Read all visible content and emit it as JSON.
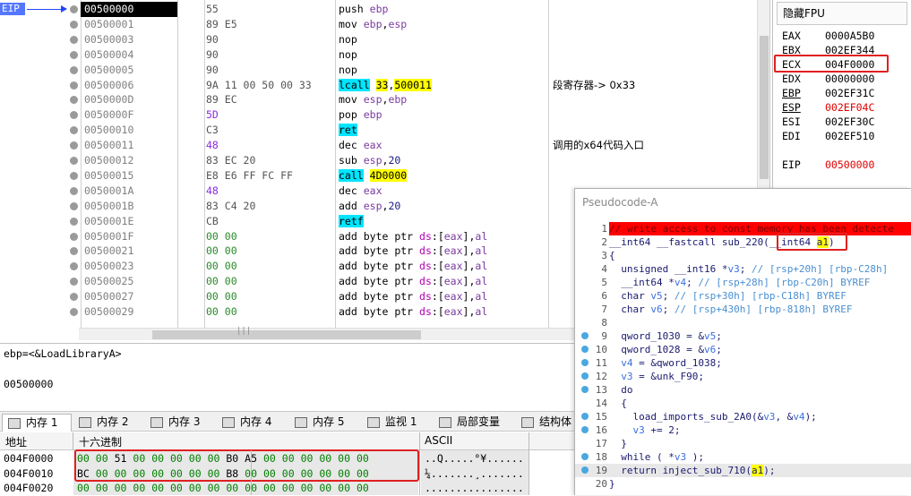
{
  "disasm": {
    "eip_label": "EIP",
    "rows": [
      {
        "addr": "00500000",
        "bytes": "55",
        "instr": "push ebp",
        "comment": ""
      },
      {
        "addr": "00500001",
        "bytes": "89 E5",
        "instr": "mov ebp,esp",
        "comment": ""
      },
      {
        "addr": "00500003",
        "bytes": "90",
        "instr": "nop",
        "comment": ""
      },
      {
        "addr": "00500004",
        "bytes": "90",
        "instr": "nop",
        "comment": ""
      },
      {
        "addr": "00500005",
        "bytes": "90",
        "instr": "nop",
        "comment": ""
      },
      {
        "addr": "00500006",
        "bytes": "9A 11 00 50 00 33",
        "instr": "lcall 33,500011",
        "comment": "段寄存器-> 0x33"
      },
      {
        "addr": "0050000D",
        "bytes": "89 EC",
        "instr": "mov esp,ebp",
        "comment": ""
      },
      {
        "addr": "0050000F",
        "bytes": "5D",
        "instr": "pop ebp",
        "comment": ""
      },
      {
        "addr": "00500010",
        "bytes": "C3",
        "instr": "ret",
        "comment": ""
      },
      {
        "addr": "00500011",
        "bytes": "48",
        "instr": "dec eax",
        "comment": "调用的x64代码入口"
      },
      {
        "addr": "00500012",
        "bytes": "83 EC 20",
        "instr": "sub esp,20",
        "comment": ""
      },
      {
        "addr": "00500015",
        "bytes": "E8 E6 FF FC FF",
        "instr": "call 4D0000",
        "comment": ""
      },
      {
        "addr": "0050001A",
        "bytes": "48",
        "instr": "dec eax",
        "comment": ""
      },
      {
        "addr": "0050001B",
        "bytes": "83 C4 20",
        "instr": "add esp,20",
        "comment": ""
      },
      {
        "addr": "0050001E",
        "bytes": "CB",
        "instr": "retf",
        "comment": ""
      },
      {
        "addr": "0050001F",
        "bytes": "00 00",
        "instr": "add byte ptr ds:[eax],al",
        "comment": ""
      },
      {
        "addr": "00500021",
        "bytes": "00 00",
        "instr": "add byte ptr ds:[eax],al",
        "comment": ""
      },
      {
        "addr": "00500023",
        "bytes": "00 00",
        "instr": "add byte ptr ds:[eax],al",
        "comment": ""
      },
      {
        "addr": "00500025",
        "bytes": "00 00",
        "instr": "add byte ptr ds:[eax],al",
        "comment": ""
      },
      {
        "addr": "00500027",
        "bytes": "00 00",
        "instr": "add byte ptr ds:[eax],al",
        "comment": ""
      },
      {
        "addr": "00500029",
        "bytes": "00 00",
        "instr": "add byte ptr ds:[eax],al",
        "comment": ""
      }
    ]
  },
  "fpu": {
    "header": "隐藏FPU",
    "registers": [
      {
        "name": "EAX",
        "value": "0000A5B0"
      },
      {
        "name": "EBX",
        "value": "002EF344"
      },
      {
        "name": "ECX",
        "value": "004F0000"
      },
      {
        "name": "EDX",
        "value": "00000000"
      },
      {
        "name": "EBP",
        "value": "002EF31C"
      },
      {
        "name": "ESP",
        "value": "002EF04C"
      },
      {
        "name": "ESI",
        "value": "002EF30C"
      },
      {
        "name": "EDI",
        "value": "002EF510"
      },
      {
        "name": "EIP",
        "value": "00500000"
      }
    ]
  },
  "info": {
    "line": "ebp=<&LoadLibraryA>",
    "value": "00500000"
  },
  "tabs": [
    {
      "label": "内存 1"
    },
    {
      "label": "内存 2"
    },
    {
      "label": "内存 3"
    },
    {
      "label": "内存 4"
    },
    {
      "label": "内存 5"
    },
    {
      "label": "监视 1"
    },
    {
      "label": "局部变量"
    },
    {
      "label": "结构体"
    }
  ],
  "dump": {
    "headers": {
      "addr": "地址",
      "hex": "十六进制",
      "ascii": "ASCII"
    },
    "rows": [
      {
        "addr": "004F0000",
        "hex1": "00 00 51 00 00 00 00 00",
        "hex2": "B0 A5 00 00 00 00 00 00",
        "ascii": "..Q.....°¥......"
      },
      {
        "addr": "004F0010",
        "hex1": "BC 00 00 00 00 00 00 00",
        "hex2": "B8 00 00 00 00 00 00 00",
        "ascii": "¼.......¸......."
      },
      {
        "addr": "004F0020",
        "hex1": "00 00 00 00 00 00 00 00",
        "hex2": "00 00 00 00 00 00 00 00",
        "ascii": "................"
      }
    ]
  },
  "pseudo": {
    "title": "Pseudocode-A",
    "lines": [
      {
        "n": "1",
        "text": "// write access to const memory has been detecte"
      },
      {
        "n": "2",
        "text": "__int64 __fastcall sub_220(__int64 a1)"
      },
      {
        "n": "3",
        "text": "{"
      },
      {
        "n": "4",
        "text": "  unsigned __int16 *v3; // [rsp+20h] [rbp-C28h]"
      },
      {
        "n": "5",
        "text": "  __int64 *v4; // [rsp+28h] [rbp-C20h] BYREF"
      },
      {
        "n": "6",
        "text": "  char v5; // [rsp+30h] [rbp-C18h] BYREF"
      },
      {
        "n": "7",
        "text": "  char v6; // [rsp+430h] [rbp-818h] BYREF"
      },
      {
        "n": "8",
        "text": ""
      },
      {
        "n": "9",
        "text": "  qword_1030 = &v5;"
      },
      {
        "n": "10",
        "text": "  qword_1028 = &v6;"
      },
      {
        "n": "11",
        "text": "  v4 = &qword_1038;"
      },
      {
        "n": "12",
        "text": "  v3 = &unk_F90;"
      },
      {
        "n": "13",
        "text": "  do"
      },
      {
        "n": "14",
        "text": "  {"
      },
      {
        "n": "15",
        "text": "    load_imports_sub_2A0(&v3, &v4);"
      },
      {
        "n": "16",
        "text": "    v3 += 2;"
      },
      {
        "n": "17",
        "text": "  }"
      },
      {
        "n": "18",
        "text": "  while ( *v3 );"
      },
      {
        "n": "19",
        "text": "  return inject_sub_710(a1);"
      },
      {
        "n": "20",
        "text": "}"
      }
    ]
  }
}
